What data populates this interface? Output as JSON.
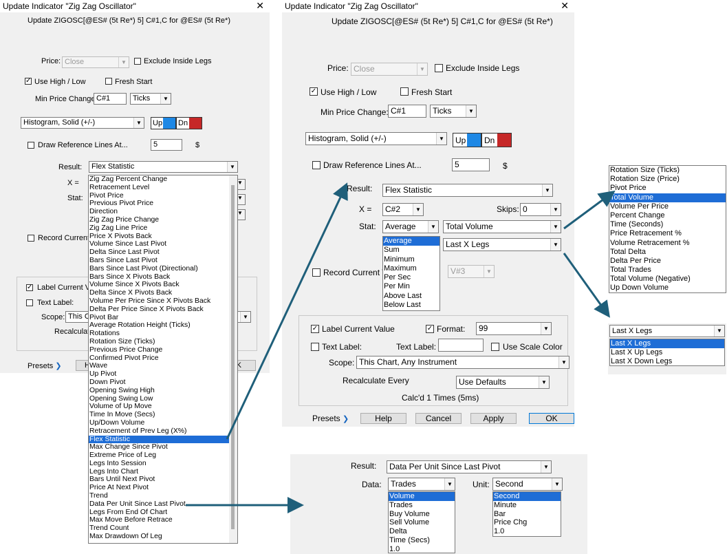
{
  "left_dialog": {
    "title": "Update Indicator \"Zig Zag Oscillator\"",
    "close": "✕",
    "subtitle": "Update ZIGOSC[@ES# (5t Re*) 5] C#1,C for @ES# (5t Re*)",
    "price_label": "Price:",
    "price_value": "Close",
    "exclude_inside_legs": "Exclude Inside Legs",
    "use_high_low": "Use High / Low",
    "fresh_start": "Fresh Start",
    "min_price_change_label": "Min Price Change:",
    "min_price_change_value": "C#1",
    "ticks": "Ticks",
    "style": "Histogram, Solid (+/-)",
    "up": "Up",
    "dn": "Dn",
    "draw_ref_lines": "Draw Reference Lines At...",
    "ref_value": "5",
    "dollar": "$",
    "result_label": "Result:",
    "result_value": "Flex Statistic",
    "x_label": "X =",
    "stat_label": "Stat:",
    "record_current": "Record Current V",
    "label_current_value": "Label Current Valu",
    "text_label": "Text Label:",
    "scope_label": "Scope:",
    "scope_value": "This Ch",
    "recalculate": "Recalculate",
    "presets": "Presets",
    "help_partial": "He",
    "ok_partial": "K",
    "result_options": [
      "Zig Zag Percent Change",
      "Retracement Level",
      "Pivot Price",
      "Previous Pivot Price",
      "Direction",
      "Zig Zag Price Change",
      "Zig Zag Line Price",
      "Price X Pivots Back",
      "Volume Since Last Pivot",
      "Delta Since Last Pivot",
      "Bars Since Last Pivot",
      "Bars Since Last Pivot (Directional)",
      "Bars Since X Pivots Back",
      "Volume Since X Pivots Back",
      "Delta Since X Pivots Back",
      "Volume Per Price Since X Pivots Back",
      "Delta Per Price Since X Pivots Back",
      "Pivot Bar",
      "Average Rotation Height (Ticks)",
      "Rotations",
      "Rotation Size (Ticks)",
      "Previous Price Change",
      "Confirmed Pivot Price",
      "Wave",
      "Up Pivot",
      "Down Pivot",
      "Opening Swing High",
      "Opening Swing Low",
      "Volume of Up Move",
      "Time In Move (Secs)",
      "Up/Down Volume",
      "Retracement of Prev Leg (X%)",
      "Flex Statistic",
      "Max Change Since Pivot",
      "Extreme Price of Leg",
      "Legs Into Session",
      "Legs Into Chart",
      "Bars Until Next Pivot",
      "Price At Next Pivot",
      "Trend",
      "Data Per Unit Since Last Pivot",
      "Legs From End Of Chart",
      "Max Move Before Retrace",
      "Trend Count",
      "Max Drawdown Of Leg"
    ],
    "result_selected_index": 32
  },
  "right_dialog": {
    "title": "Update Indicator \"Zig Zag Oscillator\"",
    "close": "✕",
    "subtitle": "Update ZIGOSC[@ES# (5t Re*) 5] C#1,C for @ES# (5t Re*)",
    "price_label": "Price:",
    "price_value": "Close",
    "exclude_inside_legs": "Exclude Inside Legs",
    "use_high_low": "Use High / Low",
    "fresh_start": "Fresh Start",
    "min_price_change_label": "Min Price Change:",
    "min_price_change_value": "C#1",
    "ticks": "Ticks",
    "style": "Histogram, Solid (+/-)",
    "up": "Up",
    "dn": "Dn",
    "draw_ref_lines": "Draw Reference Lines At...",
    "ref_value": "5",
    "dollar": "$",
    "result_label": "Result:",
    "result_value": "Flex Statistic",
    "x_label": "X =",
    "x_value": "C#2",
    "skips_label": "Skips:",
    "skips_value": "0",
    "stat_label": "Stat:",
    "stat_value": "Average",
    "stat_field": "Total Volume",
    "legs_value": "Last X Legs",
    "stat_options": [
      "Average",
      "Sum",
      "Minimum",
      "Maximum",
      "Per Sec",
      "Per Min",
      "Above Last",
      "Below Last"
    ],
    "record_current": "Record Current V",
    "record_value": "V#3",
    "label_current_value": "Label Current Value",
    "format_label": "Format:",
    "format_value": "99",
    "text_label": "Text Label:",
    "text_label2": "Text Label:",
    "use_scale_color": "Use Scale Color",
    "scope_label": "Scope:",
    "scope_value": "This Chart, Any Instrument",
    "recalculate": "Recalculate Every",
    "recalc_value": "Use Defaults",
    "calcd": "Calc'd 1 Times (5ms)",
    "presets": "Presets",
    "help": "Help",
    "cancel": "Cancel",
    "apply": "Apply",
    "ok": "OK"
  },
  "stat_field_popup": {
    "options": [
      "Rotation Size (Ticks)",
      "Rotation Size (Price)",
      "Pivot Price",
      "Total Volume",
      "Volume Per Price",
      "Percent Change",
      "Time (Seconds)",
      "Price Retracement %",
      "Volume Retracement %",
      "Total Delta",
      "Delta Per Price",
      "Total Trades",
      "Total Volume (Negative)",
      "Up Down Volume"
    ],
    "selected_index": 3
  },
  "legs_popup": {
    "value": "Last X Legs",
    "options": [
      "Last X Legs",
      "Last X Up Legs",
      "Last X Down Legs"
    ],
    "selected_index": 0
  },
  "data_panel": {
    "result_label": "Result:",
    "result_value": "Data Per Unit Since Last Pivot",
    "data_label": "Data:",
    "data_value": "Trades",
    "unit_label": "Unit:",
    "unit_value": "Second",
    "data_options": [
      "Volume",
      "Trades",
      "Buy Volume",
      "Sell Volume",
      "Delta",
      "Time (Secs)",
      "1.0"
    ],
    "unit_options": [
      "Second",
      "Minute",
      "Bar",
      "Price Chg",
      "1.0"
    ]
  },
  "colors": {
    "accent": "#1e6dd6",
    "arrow": "#1f5f7a",
    "up_swatch": "#1e88e5",
    "dn_swatch": "#c62828"
  }
}
